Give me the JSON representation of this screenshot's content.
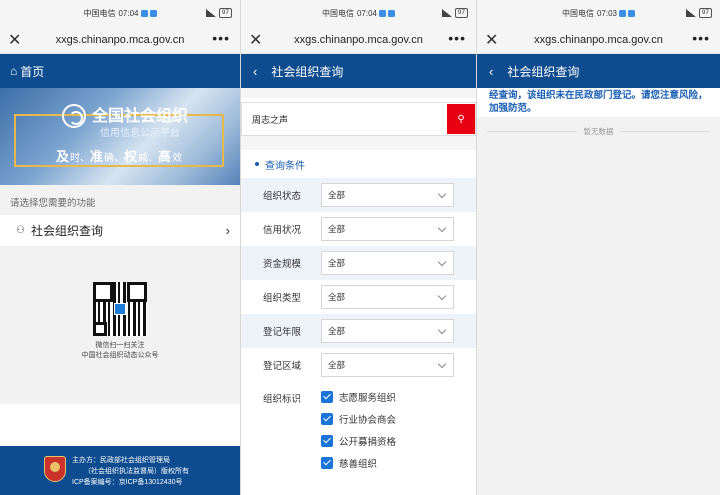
{
  "status_bars": [
    {
      "carrier": "中国电信",
      "time": "07:04",
      "battery": "97"
    },
    {
      "carrier": "中国电信",
      "time": "07:04",
      "battery": "97"
    },
    {
      "carrier": "中国电信",
      "time": "07:03",
      "battery": "97"
    }
  ],
  "browser": {
    "url": "xxgs.chinanpo.mca.gov.cn",
    "close": "✕",
    "more": "•••"
  },
  "home": {
    "header": "首页",
    "banner": {
      "title": "全国社会组织",
      "subtitle": "信用信息公示平台",
      "slogan_parts": [
        "及",
        "时、",
        "准",
        "确、",
        "权",
        "威、",
        "高",
        "效"
      ]
    },
    "function_title": "请选择您需要的功能",
    "menu_item": "社会组织查询",
    "qr_caption_1": "微信扫一扫关注",
    "qr_caption_2": "中国社会组织动态公众号",
    "footer": {
      "line1": "主办方：民政部社会组织管理局",
      "line2": "（社会组织执法监督局）版权所有",
      "line3": "ICP备案编号：京ICP备13012430号"
    }
  },
  "query": {
    "header": "社会组织查询",
    "search": {
      "value": "周志之声"
    },
    "condition_title": "查询条件",
    "filters": [
      {
        "label": "组织状态",
        "value": "全部"
      },
      {
        "label": "信用状况",
        "value": "全部"
      },
      {
        "label": "资金规模",
        "value": "全部"
      },
      {
        "label": "组织类型",
        "value": "全部"
      },
      {
        "label": "登记年限",
        "value": "全部"
      },
      {
        "label": "登记区域",
        "value": "全部"
      }
    ],
    "marks_label": "组织标识",
    "marks": [
      "志愿服务组织",
      "行业协会商会",
      "公开募捐资格",
      "慈善组织"
    ]
  },
  "result": {
    "header": "社会组织查询",
    "notice": "经查询，该组织未在民政部门登记。请您注意风险，加强防范。",
    "empty": "暂无数据"
  },
  "colors": {
    "brand_blue": "#0e4c8f",
    "search_red": "#e60012",
    "link_blue": "#1a5fb4"
  }
}
